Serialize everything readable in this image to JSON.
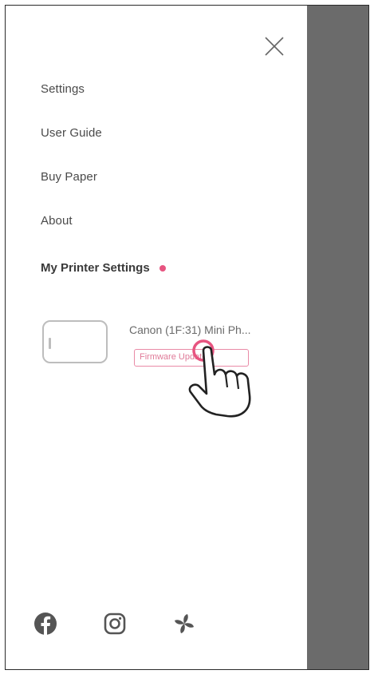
{
  "drawer": {
    "close_icon": "close-icon",
    "menu": [
      {
        "label": "Settings"
      },
      {
        "label": "User Guide"
      },
      {
        "label": "Buy Paper"
      },
      {
        "label": "About"
      }
    ],
    "section_title": "My Printer Settings",
    "section_dot_color": "#e75480"
  },
  "printer": {
    "name": "Canon (1F:31) Mini Ph...",
    "badge_label": "Firmware Update",
    "badge_color": "#e98aa6"
  },
  "social": [
    {
      "icon": "facebook-icon"
    },
    {
      "icon": "instagram-icon"
    },
    {
      "icon": "pinwheel-icon"
    }
  ],
  "overlay_color": "#6b6b6b"
}
